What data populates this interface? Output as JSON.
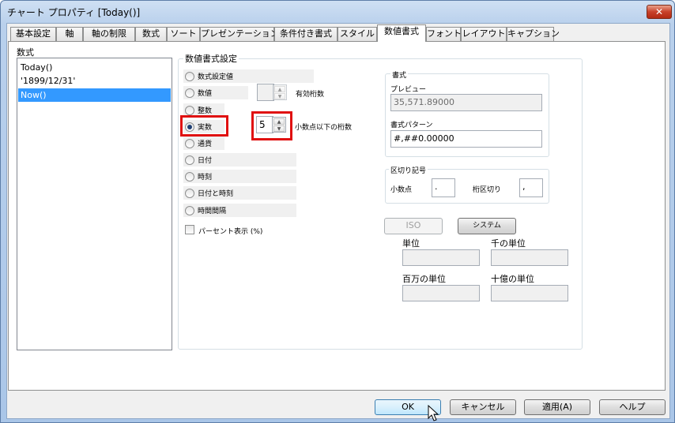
{
  "window": {
    "title": "チャート プロパティ [Today()]",
    "close_symbol": "✕"
  },
  "tabs": [
    {
      "label": "基本設定"
    },
    {
      "label": "軸"
    },
    {
      "label": "軸の制限"
    },
    {
      "label": "数式"
    },
    {
      "label": "ソート"
    },
    {
      "label": "プレゼンテーション"
    },
    {
      "label": "条件付き書式"
    },
    {
      "label": "スタイル"
    },
    {
      "label": "数値書式"
    },
    {
      "label": "フォント"
    },
    {
      "label": "レイアウト"
    },
    {
      "label": "キャプション"
    }
  ],
  "active_tab": "数値書式",
  "expressions": {
    "label": "数式",
    "items": [
      {
        "label": "Today()"
      },
      {
        "label": "'1899/12/31'"
      },
      {
        "label": "Now()"
      }
    ],
    "selected": "Now()"
  },
  "number_format": {
    "group_label": "数値書式設定",
    "options": [
      {
        "label": "数式設定値"
      },
      {
        "label": "数値"
      },
      {
        "label": "整数"
      },
      {
        "label": "実数"
      },
      {
        "label": "通貨"
      },
      {
        "label": "日付"
      },
      {
        "label": "時刻"
      },
      {
        "label": "日付と時刻"
      },
      {
        "label": "時間間隔"
      }
    ],
    "selected": "実数",
    "significant_digits_label": "有効桁数",
    "significant_digits_value": "",
    "decimals_label": "小数点以下の桁数",
    "decimals_value": "5",
    "percent_label": "パーセント表示 (%)",
    "percent_checked": false
  },
  "format": {
    "group_label": "書式",
    "preview_label": "プレビュー",
    "preview_value": "35,571.89000",
    "pattern_label": "書式パターン",
    "pattern_value": "#,##0.00000"
  },
  "separators": {
    "group_label": "区切り記号",
    "decimal_label": "小数点",
    "decimal_value": ".",
    "thousand_label": "桁区切り",
    "thousand_value": ","
  },
  "units": {
    "iso_button": "ISO",
    "system_button": "システム",
    "unit_label": "単位",
    "thousand_unit_label": "千の単位",
    "million_unit_label": "百万の単位",
    "billion_unit_label": "十億の単位"
  },
  "footer": {
    "ok": "OK",
    "cancel": "キャンセル",
    "apply": "適用(A)",
    "help": "ヘルプ"
  },
  "colors": {
    "highlight": "#e01010",
    "selection": "#3399ff"
  }
}
